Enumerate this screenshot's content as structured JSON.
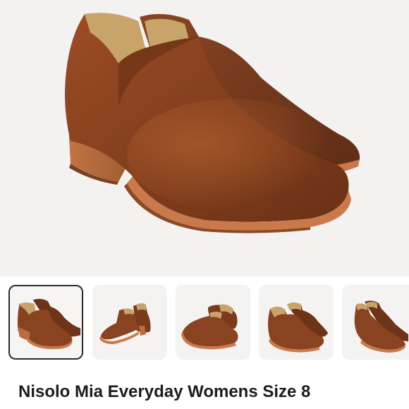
{
  "listing": {
    "title": "Nisolo Mia Everyday Womens Size 8"
  },
  "gallery": {
    "selected_index": 0,
    "thumbnail_count_visible": 5
  },
  "colors": {
    "leather": "#7a3a1c",
    "leather_light": "#a8552b",
    "sole": "#c9794a",
    "lining": "#c9a46a",
    "background": "#f3f2f1",
    "selected_border": "#2b2b2b",
    "title_text": "#1c1c1c"
  },
  "icons": [
    "boot-product-image"
  ]
}
